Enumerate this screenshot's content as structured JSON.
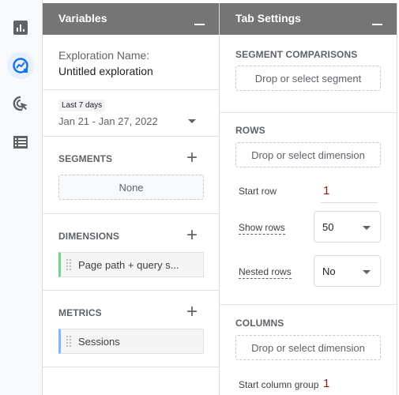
{
  "rail": {
    "icons": [
      "bar-chart-icon",
      "exploration-icon",
      "click-cursor-icon",
      "list-table-icon"
    ],
    "active_index": 1,
    "active_color": "#1a73e8"
  },
  "variables": {
    "title": "Variables",
    "exploration_name_label": "Exploration Name:",
    "exploration_name": "Untitled exploration",
    "date_range_chip": "Last 7 days",
    "date_range": "Jan 21 - Jan 27, 2022",
    "segments": {
      "title": "SEGMENTS",
      "items": [
        "None"
      ]
    },
    "dimensions": {
      "title": "DIMENSIONS",
      "items": [
        "Page path + query s..."
      ],
      "color": "#81c995"
    },
    "metrics": {
      "title": "METRICS",
      "items": [
        "Sessions"
      ],
      "color": "#8ab4f8"
    }
  },
  "tab_settings": {
    "title": "Tab Settings",
    "segment_comparisons": {
      "title": "SEGMENT COMPARISONS",
      "drop": "Drop or select segment"
    },
    "rows": {
      "title": "ROWS",
      "drop": "Drop or select dimension",
      "start_row_label": "Start row",
      "start_row": "1",
      "show_rows_label": "Show rows",
      "show_rows": "50",
      "nested_rows_label": "Nested rows",
      "nested_rows": "No"
    },
    "columns": {
      "title": "COLUMNS",
      "drop": "Drop or select dimension",
      "start_column_group_label": "Start column group",
      "start_column_group": "1"
    }
  }
}
